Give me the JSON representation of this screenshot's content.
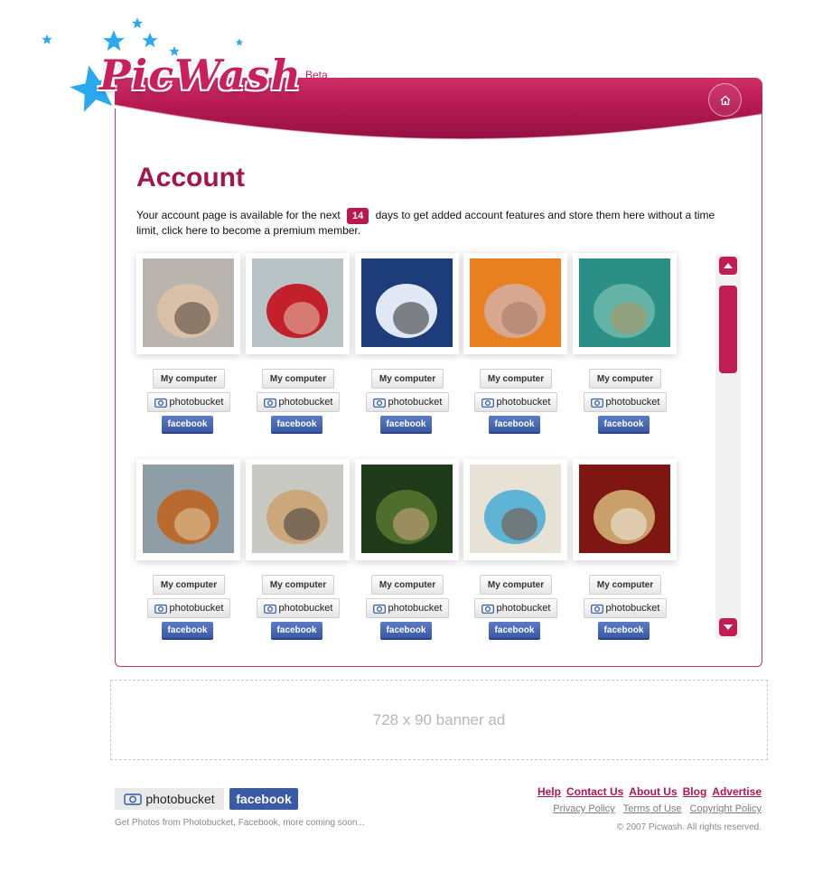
{
  "header": {
    "logo_text": "PicWash",
    "logo_badge": "Beta"
  },
  "page": {
    "title": "Account",
    "intro_before": "Your account page is available for the next ",
    "days": "14",
    "intro_after": " days to get added account features and store them here without a time limit, click here to become a premium member."
  },
  "gallery": {
    "button_labels": {
      "my_computer": "My computer",
      "photobucket": "photobucket",
      "facebook": "facebook"
    },
    "photos": [
      {
        "subject": "man-portrait",
        "colors": [
          "#b9b5ae",
          "#d9c0a6",
          "#4a3f36"
        ]
      },
      {
        "subject": "boxing-gloves",
        "colors": [
          "#b8c3c6",
          "#c2202a",
          "#e8c6b0"
        ]
      },
      {
        "subject": "wakeboarder-splash",
        "colors": [
          "#1d3c7a",
          "#dfe8f4",
          "#2a2a2a"
        ]
      },
      {
        "subject": "legs-on-orange",
        "colors": [
          "#e8801f",
          "#d8a78f",
          "#9f7a68"
        ]
      },
      {
        "subject": "underwater-turtle",
        "colors": [
          "#2c8f86",
          "#64b3a7",
          "#b3925b"
        ]
      },
      {
        "subject": "couple-walking",
        "colors": [
          "#8e9da6",
          "#b86a2f",
          "#e3d0a6"
        ]
      },
      {
        "subject": "couple-kissing",
        "colors": [
          "#c9c9c4",
          "#cda77c",
          "#3a3a3a"
        ]
      },
      {
        "subject": "jungle-foliage",
        "colors": [
          "#1e3a18",
          "#4f6e2c",
          "#d8a88a"
        ]
      },
      {
        "subject": "woman-with-lotion",
        "colors": [
          "#e8e2d6",
          "#5db4d4",
          "#7b4b32"
        ]
      },
      {
        "subject": "buddha-statue",
        "colors": [
          "#7e1612",
          "#c9a06a",
          "#f1ece4"
        ]
      }
    ]
  },
  "banner": {
    "text": "728 x 90 banner ad"
  },
  "footer": {
    "photobucket_logo": "photobucket",
    "facebook_logo": "facebook",
    "tagline": "Get Photos from Photobucket, Facebook, more coming soon...",
    "primary_links": [
      "Help",
      "Contact Us",
      "About Us",
      "Blog",
      "Advertise"
    ],
    "secondary_links": [
      "Privacy Policy",
      "Terms of Use",
      "Copyright Policy"
    ],
    "copyright": "© 2007 Picwash. All rights reserved."
  },
  "colors": {
    "brand": "#c01d55",
    "title": "#a4154d",
    "facebook": "#3b5aa6",
    "star": "#2aa9ee"
  }
}
